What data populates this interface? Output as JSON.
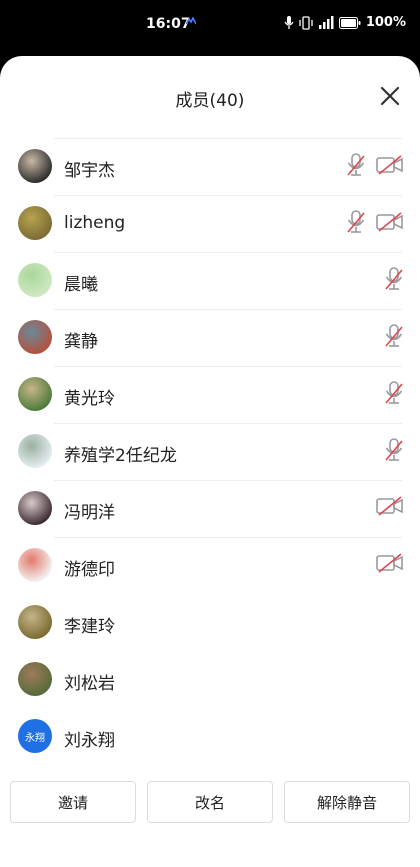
{
  "status_bar": {
    "time": "16:07",
    "battery_percent": "100%",
    "icons": [
      "mic-in-use-icon",
      "vibrate-icon",
      "signal-icon",
      "battery-icon"
    ]
  },
  "header": {
    "title": "成员(40)",
    "close_icon": "close-icon"
  },
  "members": [
    {
      "name": "邹宇杰",
      "mic_muted": true,
      "camera_off": true,
      "avatar_colors": [
        "#2b2b2b",
        "#c9b9a6"
      ]
    },
    {
      "name": "lizheng",
      "mic_muted": true,
      "camera_off": true,
      "avatar_colors": [
        "#7a6a35",
        "#b8a34f"
      ]
    },
    {
      "name": "晨曦",
      "mic_muted": true,
      "camera_off": false,
      "avatar_colors": [
        "#cfe9c3",
        "#a9d79a"
      ]
    },
    {
      "name": "龚静",
      "mic_muted": true,
      "camera_off": false,
      "avatar_colors": [
        "#b5503c",
        "#6a8a9a"
      ]
    },
    {
      "name": "黄光玲",
      "mic_muted": true,
      "camera_off": false,
      "avatar_colors": [
        "#4a7a3a",
        "#c9b58a"
      ]
    },
    {
      "name": "养殖学2任纪龙",
      "mic_muted": true,
      "camera_off": false,
      "avatar_colors": [
        "#e6eef2",
        "#9ab0a0"
      ]
    },
    {
      "name": "冯明洋",
      "mic_muted": false,
      "camera_off": true,
      "avatar_colors": [
        "#3a2a30",
        "#d9c9c9"
      ]
    },
    {
      "name": "游德印",
      "mic_muted": false,
      "camera_off": true,
      "avatar_colors": [
        "#f4f4f4",
        "#e37a6a"
      ]
    },
    {
      "name": "李建玲",
      "mic_muted": false,
      "camera_off": false,
      "avatar_colors": [
        "#7a6a30",
        "#c4b48a"
      ]
    },
    {
      "name": "刘松岩",
      "mic_muted": false,
      "camera_off": false,
      "avatar_colors": [
        "#556b3a",
        "#a07a5a"
      ]
    },
    {
      "name": "刘永翔",
      "mic_muted": false,
      "camera_off": false,
      "avatar_colors": [
        "#1f6fe5",
        "#1f6fe5"
      ],
      "avatar_text": "永翔"
    }
  ],
  "footer": {
    "invite_label": "邀请",
    "rename_label": "改名",
    "unmute_label": "解除静音"
  },
  "colors": {
    "muted_red": "#e0454f",
    "icon_gray": "#9a9a9a",
    "accent_blue": "#1f6fe5"
  }
}
